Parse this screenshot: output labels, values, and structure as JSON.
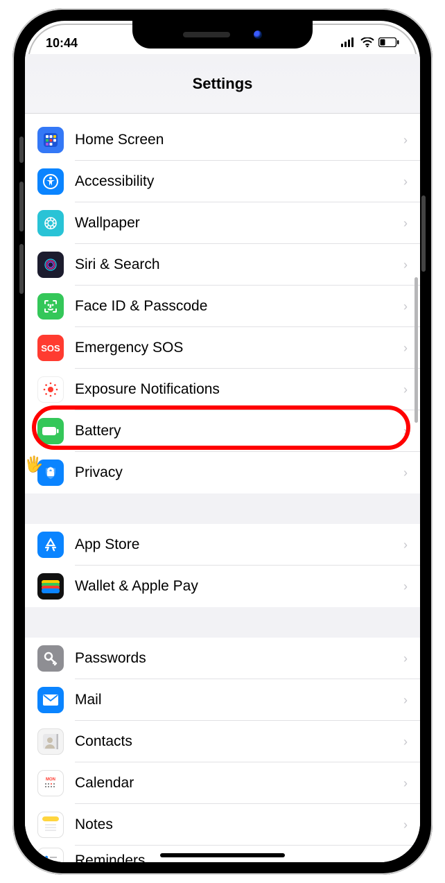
{
  "status": {
    "time": "10:44"
  },
  "header": {
    "title": "Settings"
  },
  "highlight_index": 7,
  "groups": [
    {
      "items": [
        {
          "label": "Home Screen",
          "icon": "home-screen-icon"
        },
        {
          "label": "Accessibility",
          "icon": "accessibility-icon"
        },
        {
          "label": "Wallpaper",
          "icon": "wallpaper-icon"
        },
        {
          "label": "Siri & Search",
          "icon": "siri-icon"
        },
        {
          "label": "Face ID & Passcode",
          "icon": "face-id-icon"
        },
        {
          "label": "Emergency SOS",
          "icon": "sos-icon"
        },
        {
          "label": "Exposure Notifications",
          "icon": "exposure-icon"
        },
        {
          "label": "Battery",
          "icon": "battery-icon"
        },
        {
          "label": "Privacy",
          "icon": "privacy-icon"
        }
      ]
    },
    {
      "items": [
        {
          "label": "App Store",
          "icon": "app-store-icon"
        },
        {
          "label": "Wallet & Apple Pay",
          "icon": "wallet-icon"
        }
      ]
    },
    {
      "items": [
        {
          "label": "Passwords",
          "icon": "passwords-icon"
        },
        {
          "label": "Mail",
          "icon": "mail-icon"
        },
        {
          "label": "Contacts",
          "icon": "contacts-icon"
        },
        {
          "label": "Calendar",
          "icon": "calendar-icon"
        },
        {
          "label": "Notes",
          "icon": "notes-icon"
        },
        {
          "label": "Reminders",
          "icon": "reminders-icon"
        }
      ]
    }
  ]
}
